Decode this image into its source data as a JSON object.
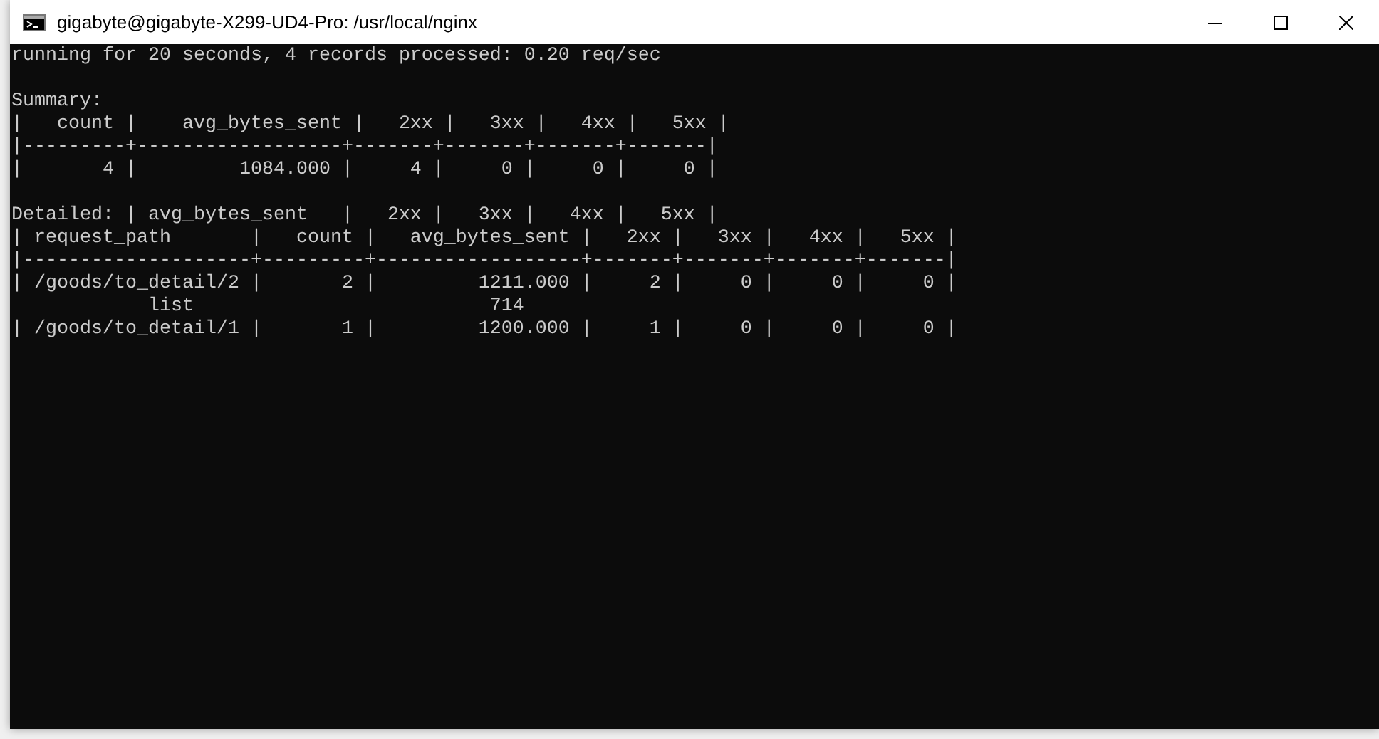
{
  "window": {
    "title": "gigabyte@gigabyte-X299-UD4-Pro: /usr/local/nginx"
  },
  "console": {
    "blocks": [
      {
        "lines": [
          "running for 20 seconds, 4 records processed: 0.20 req/sec"
        ]
      },
      {
        "lines": [
          "Summary:",
          "|   count |    avg_bytes_sent |   2xx |   3xx |   4xx |   5xx |",
          "|---------+------------------+-------+-------+-------+-------|",
          "|       4 |         1084.000 |     4 |     0 |     0 |     0 |"
        ]
      },
      {
        "lines": [
          "Detailed: | avg_bytes_sent   |   2xx |   3xx |   4xx |   5xx |",
          "| request_path       |   count |   avg_bytes_sent |   2xx |   3xx |   4xx |   5xx |",
          "|--------------------+---------+------------------+-------+-------+-------+-------|",
          "| /goods/to_detail/2 |       2 |         1211.000 |     2 |     0 |     0 |     0 |",
          "            list                          714",
          "| /goods/to_detail/1 |       1 |         1200.000 |     1 |     0 |     0 |     0 |"
        ]
      }
    ]
  }
}
